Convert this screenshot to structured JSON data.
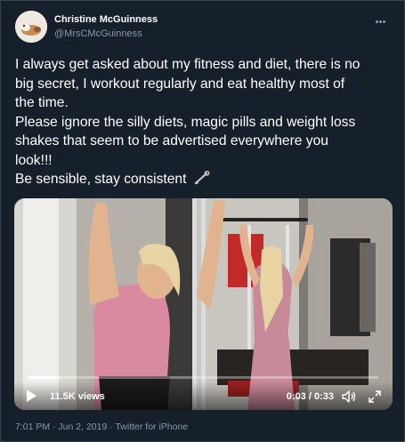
{
  "author": {
    "name": "Christine McGuinness",
    "handle": "@MrsCMcGuinness"
  },
  "tweet": {
    "lines": [
      "I always get asked about my fitness and diet, there is no",
      "big secret, I workout regularly and eat healthy most of",
      "the time.",
      "Please ignore the silly diets, magic pills and weight loss",
      "shakes that seem to be advertised everywhere you",
      "look!!!",
      "Be sensible, stay consistent"
    ]
  },
  "video": {
    "views": "11.5K views",
    "time": "0:03 / 0:33",
    "progress": 0.09
  },
  "meta": {
    "timestamp": "7:01 PM · Jun 2, 2019 · Twitter for iPhone"
  },
  "icons": [
    "more-icon",
    "muscle-emoji-icon",
    "play-icon",
    "volume-icon",
    "fullscreen-icon"
  ]
}
